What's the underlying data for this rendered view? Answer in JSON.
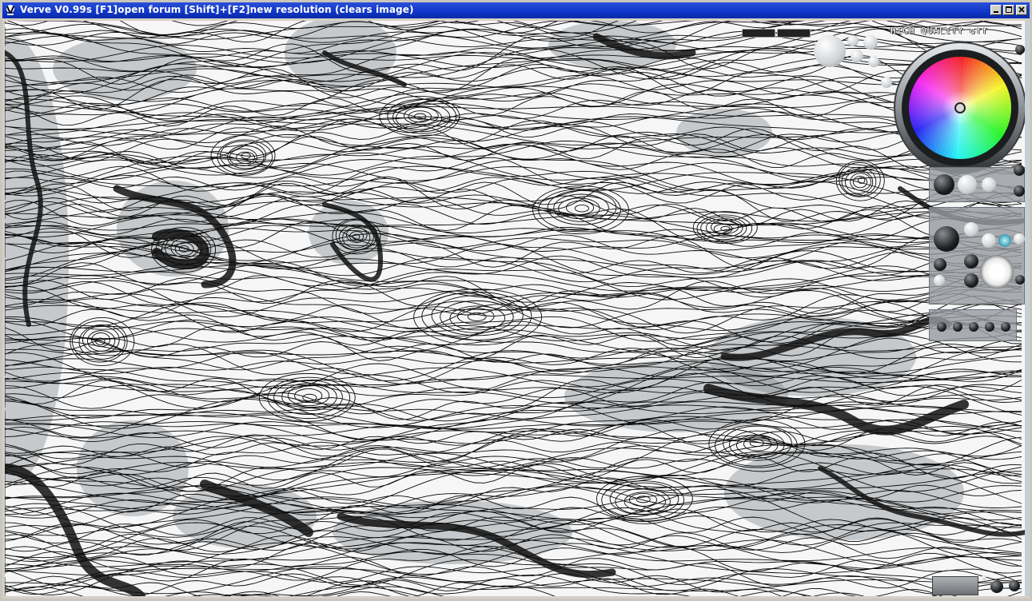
{
  "window": {
    "title": "Verve V0.99s [F1]open forum   [Shift]+[F2]new resolution (clears image)",
    "app_icon": "verve-app-icon",
    "controls": [
      "minimize-icon",
      "maximize-icon",
      "close-icon"
    ]
  },
  "toolbar": {
    "quality_label": "HIGH QUALITY off"
  },
  "colors": {
    "titlebar": "#0f36c8",
    "canvas_ink": "#0a0a0a",
    "panel": "#969ba0"
  }
}
